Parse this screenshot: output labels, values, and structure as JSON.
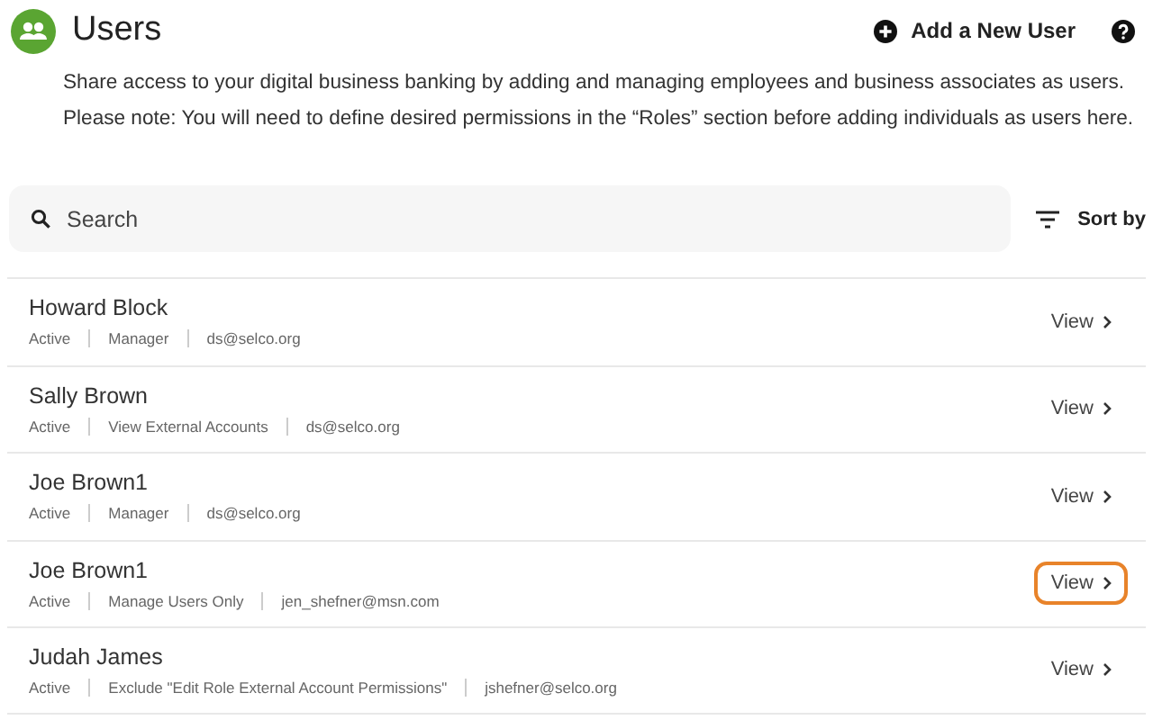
{
  "header": {
    "title": "Users",
    "add_button": "Add a New User"
  },
  "description": [
    "Share access to your digital business banking by adding and managing employees and business associates as users.",
    "Please note: You will need to define desired permissions in the “Roles” section before adding individuals as users here."
  ],
  "search": {
    "placeholder": "Search"
  },
  "sort": {
    "label": "Sort by"
  },
  "users": [
    {
      "name": "Howard Block",
      "details": [
        "Active",
        "Manager",
        "ds@selco.org"
      ],
      "action": "View",
      "focused": false
    },
    {
      "name": "Sally Brown",
      "details": [
        "Active",
        "View External Accounts",
        "ds@selco.org"
      ],
      "action": "View",
      "focused": false
    },
    {
      "name": "Joe Brown1",
      "details": [
        "Active",
        "Manager",
        "ds@selco.org"
      ],
      "action": "View",
      "focused": false
    },
    {
      "name": "Joe Brown1",
      "details": [
        "Active",
        "Manage Users Only",
        "jen_shefner@msn.com"
      ],
      "action": "View",
      "focused": true
    },
    {
      "name": "Judah James",
      "details": [
        "Active",
        "Exclude \"Edit Role External Account Permissions\"",
        "jshefner@selco.org"
      ],
      "action": "View",
      "focused": false
    }
  ]
}
